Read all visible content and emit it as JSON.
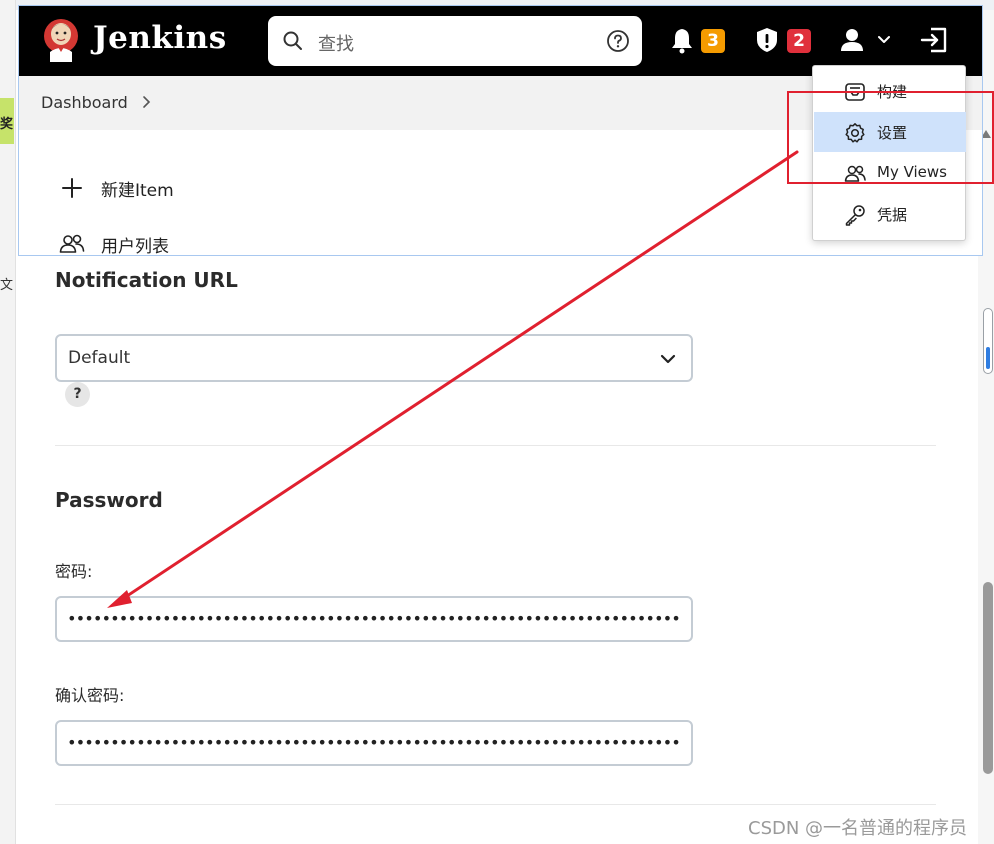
{
  "header": {
    "app_title": "Jenkins",
    "search_placeholder": "查找",
    "notifications_count": "3",
    "security_count": "2",
    "notification_badge_color": "#f59b00",
    "security_badge_color": "#e0303c"
  },
  "breadcrumb": {
    "items": [
      "Dashboard"
    ]
  },
  "tasks": {
    "items": [
      {
        "label": "新建Item",
        "icon": "plus-icon"
      },
      {
        "label": "用户列表",
        "icon": "people-icon"
      }
    ]
  },
  "user_menu": {
    "items": [
      {
        "label": "构建",
        "icon": "builds-icon"
      },
      {
        "label": "设置",
        "icon": "gear-icon",
        "active": true
      },
      {
        "label": "My Views",
        "icon": "people-icon"
      },
      {
        "label": "凭据",
        "icon": "key-icon"
      }
    ]
  },
  "form": {
    "notification_url": {
      "title": "Notification URL",
      "selected": "Default",
      "help": "?"
    },
    "password": {
      "title": "Password",
      "password_label": "密码:",
      "password_value": "••••••••••••••••••••••••••••••••••••••••••••••••••••••••••••••••••••••••••••••••••••",
      "confirm_label": "确认密码:",
      "confirm_value": "••••••••••••••••••••••••••••••••••••••••••••••••••••••••••••••••••••••••••••••••••••"
    }
  },
  "background": {
    "left_chip_text": "奖",
    "left_text": "文"
  },
  "annotation": {
    "color": "#e0202f"
  },
  "watermark": "CSDN @一名普通的程序员"
}
